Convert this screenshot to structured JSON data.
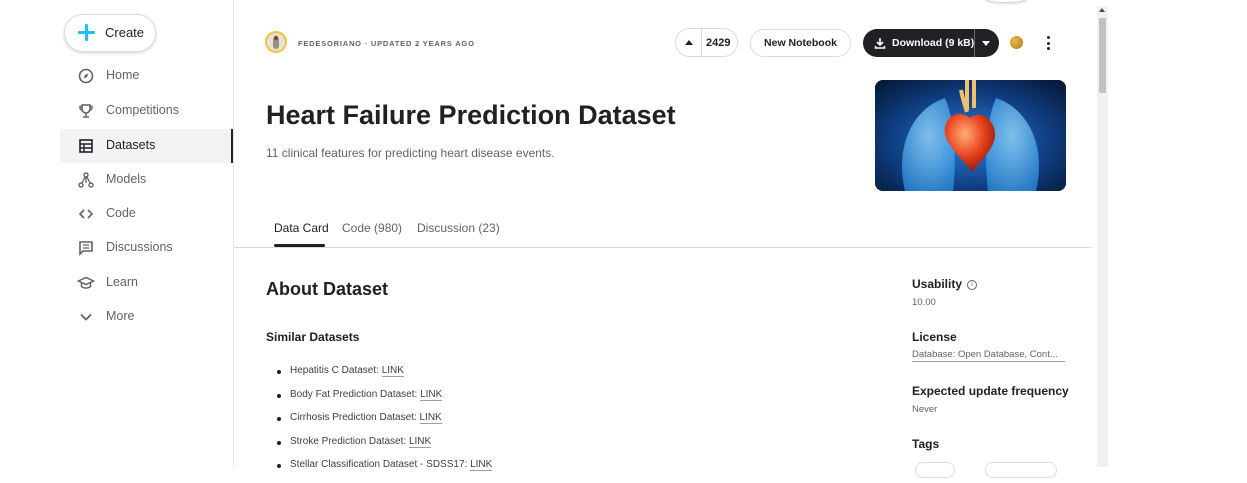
{
  "sidebar": {
    "create_label": "Create",
    "items": [
      {
        "label": "Home",
        "icon": "compass-icon"
      },
      {
        "label": "Competitions",
        "icon": "trophy-icon"
      },
      {
        "label": "Datasets",
        "icon": "table-icon",
        "active": true
      },
      {
        "label": "Models",
        "icon": "models-icon"
      },
      {
        "label": "Code",
        "icon": "code-icon"
      },
      {
        "label": "Discussions",
        "icon": "discussion-icon"
      },
      {
        "label": "Learn",
        "icon": "graduation-cap-icon"
      },
      {
        "label": "More",
        "icon": "chevron-down-icon"
      }
    ]
  },
  "header": {
    "owner_line": "FEDESORIANO · UPDATED 2 YEARS AGO",
    "vote_count": "2429",
    "new_notebook_label": "New Notebook",
    "download_label": "Download (9 kB)"
  },
  "dataset": {
    "title": "Heart Failure Prediction Dataset",
    "subtitle": "11 clinical features for predicting heart disease events."
  },
  "tabs": [
    {
      "label": "Data Card",
      "active": true
    },
    {
      "label": "Code (980)"
    },
    {
      "label": "Discussion (23)"
    }
  ],
  "about": {
    "title": "About Dataset",
    "similar_title": "Similar Datasets",
    "similar": [
      {
        "text": "Hepatitis C Dataset: ",
        "link": "LINK"
      },
      {
        "text": "Body Fat Prediction Dataset: ",
        "link": "LINK"
      },
      {
        "text": "Cirrhosis Prediction Dataset: ",
        "link": "LINK"
      },
      {
        "text": "Stroke Prediction Dataset: ",
        "link": "LINK"
      },
      {
        "text": "Stellar Classification Dataset - SDSS17: ",
        "link": "LINK"
      }
    ]
  },
  "meta": {
    "usability_label": "Usability",
    "usability_value": "10.00",
    "license_label": "License",
    "license_value": "Database: Open Database, Cont...",
    "frequency_label": "Expected update frequency",
    "frequency_value": "Never",
    "tags_label": "Tags"
  },
  "colors": {
    "accent": "#20beff",
    "dark_button": "#202124",
    "medal": "#c8961e"
  }
}
